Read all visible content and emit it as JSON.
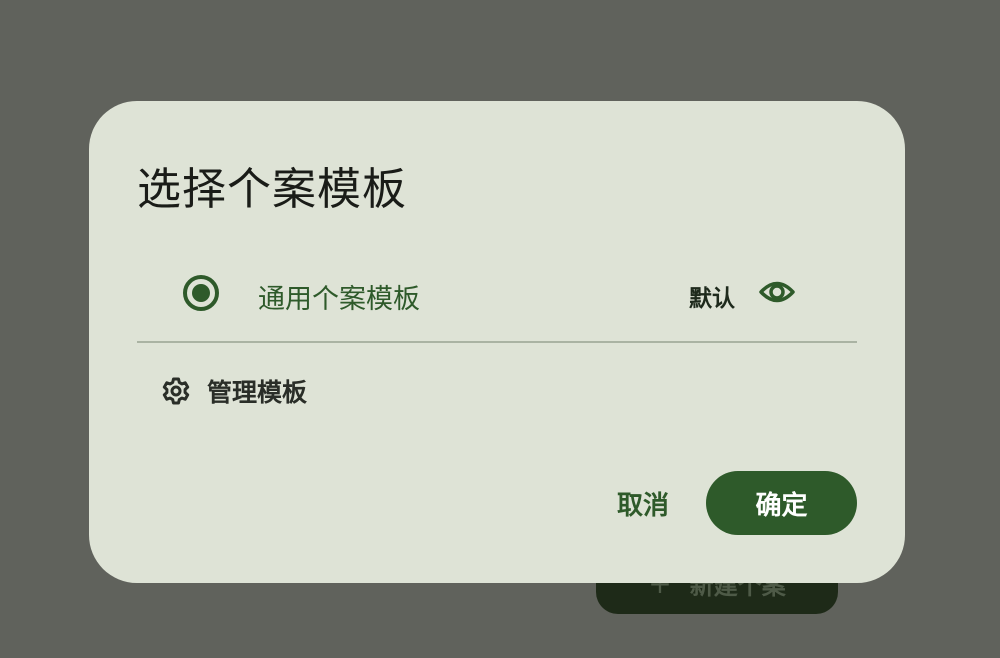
{
  "colors": {
    "scrim": "#60625c",
    "dialog_bg": "#dee3d6",
    "primary": "#2e5a2a",
    "on_primary": "#ffffff",
    "divider": "#aab3a3",
    "fab_bg": "#1e2a18"
  },
  "background": {
    "fab_icon": "plus-icon",
    "fab_label": "新建个案"
  },
  "dialog": {
    "title": "选择个案模板",
    "options": [
      {
        "label": "通用个案模板",
        "selected": true,
        "badge": "默认",
        "preview_icon": "eye-icon"
      }
    ],
    "manage": {
      "icon": "gear-icon",
      "label": "管理模板"
    },
    "buttons": {
      "cancel": "取消",
      "confirm": "确定"
    }
  }
}
